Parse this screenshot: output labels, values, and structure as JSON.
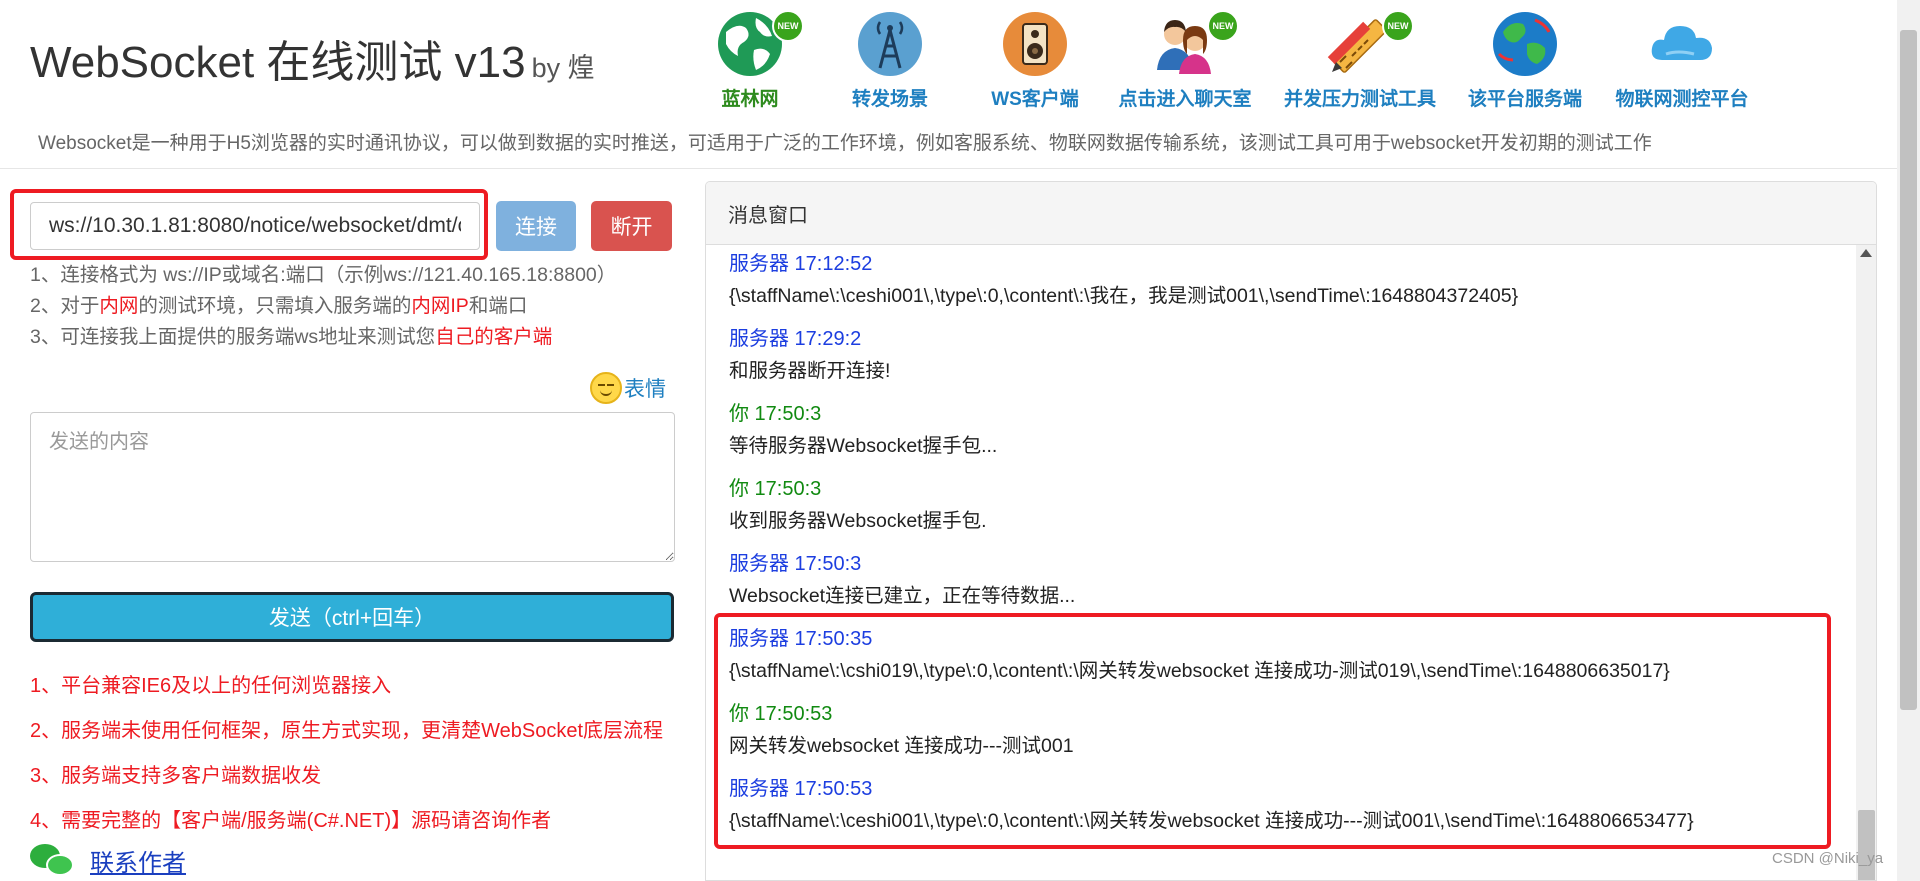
{
  "header": {
    "title": "WebSocket 在线测试 v13",
    "byline": "by 煌",
    "nav": [
      {
        "label": "蓝林网",
        "icon": "globe-icon",
        "new": true
      },
      {
        "label": "转发场景",
        "icon": "antenna-tower-icon",
        "new": false
      },
      {
        "label": "WS客户端",
        "icon": "speaker-icon",
        "new": false
      },
      {
        "label": "点击进入聊天室",
        "icon": "people-chat-icon",
        "new": true
      },
      {
        "label": "并发压力测试工具",
        "icon": "ruler-pencil-icon",
        "new": true
      },
      {
        "label": "该平台服务端",
        "icon": "earth-icon",
        "new": false
      },
      {
        "label": "物联网测控平台",
        "icon": "cloud-icon",
        "new": false
      }
    ],
    "new_badge": "NEW",
    "description": "Websocket是一种用于H5浏览器的实时通讯协议，可以做到数据的实时推送，可适用于广泛的工作环境，例如客服系统、物联网数据传输系统，该测试工具可用于websocket开发初期的测试工作"
  },
  "connect": {
    "url_value": "ws://10.30.1.81:8080/notice/websocket/dmt/c",
    "connect_label": "连接",
    "disconnect_label": "断开"
  },
  "tips": {
    "line1": "1、连接格式为 ws://IP或域名:端口（示例ws://121.40.165.18:8800）",
    "line2_a": "2、对于",
    "line2_red1": "内网",
    "line2_b": "的测试环境，只需填入服务端的",
    "line2_red2": "内网IP",
    "line2_c": "和端口",
    "line3_a": "3、可连接我上面提供的服务端ws地址来测试您",
    "line3_red": "自己的客户端"
  },
  "emoji": {
    "label": "表情",
    "icon": "smiley-icon"
  },
  "send": {
    "placeholder": "发送的内容",
    "button_label": "发送（ctrl+回车）"
  },
  "features": [
    "1、平台兼容IE6及以上的任何浏览器接入",
    "2、服务端未使用任何框架，原生方式实现，更清楚WebSocket底层流程",
    "3、服务端支持多客户端数据收发",
    "4、需要完整的【客户端/服务端(C#.NET)】源码请咨询作者"
  ],
  "contact": {
    "label": "联系作者",
    "icon": "wechat-icon"
  },
  "message_window": {
    "title": "消息窗口",
    "messages": [
      {
        "sender": "server",
        "head": "服务器 17:12:52",
        "text": "{\\staffName\\:\\ceshi001\\,\\type\\:0,\\content\\:\\我在，我是测试001\\,\\sendTime\\:1648804372405}"
      },
      {
        "sender": "server",
        "head": "服务器 17:29:2",
        "text": "和服务器断开连接!"
      },
      {
        "sender": "you",
        "head": "你 17:50:3",
        "text": "等待服务器Websocket握手包..."
      },
      {
        "sender": "you",
        "head": "你 17:50:3",
        "text": "收到服务器Websocket握手包."
      },
      {
        "sender": "server",
        "head": "服务器 17:50:3",
        "text": "Websocket连接已建立，正在等待数据..."
      },
      {
        "sender": "server",
        "head": "服务器 17:50:35",
        "text": "{\\staffName\\:\\cshi019\\,\\type\\:0,\\content\\:\\网关转发websocket 连接成功-测试019\\,\\sendTime\\:1648806635017}"
      },
      {
        "sender": "you",
        "head": "你 17:50:53",
        "text": "网关转发websocket 连接成功---测试001"
      },
      {
        "sender": "server",
        "head": "服务器 17:50:53",
        "text": "{\\staffName\\:\\ceshi001\\,\\type\\:0,\\content\\:\\网关转发websocket 连接成功---测试001\\,\\sendTime\\:1648806653477}"
      }
    ]
  },
  "watermark": "CSDN @Niki_ya",
  "colors": {
    "highlight": "#ee1b22",
    "server_text": "#1c3ee0",
    "you_text": "#118a11",
    "send_button": "#2fafd8",
    "disconnect_button": "#d9534f",
    "connect_button": "#7fb1de"
  }
}
